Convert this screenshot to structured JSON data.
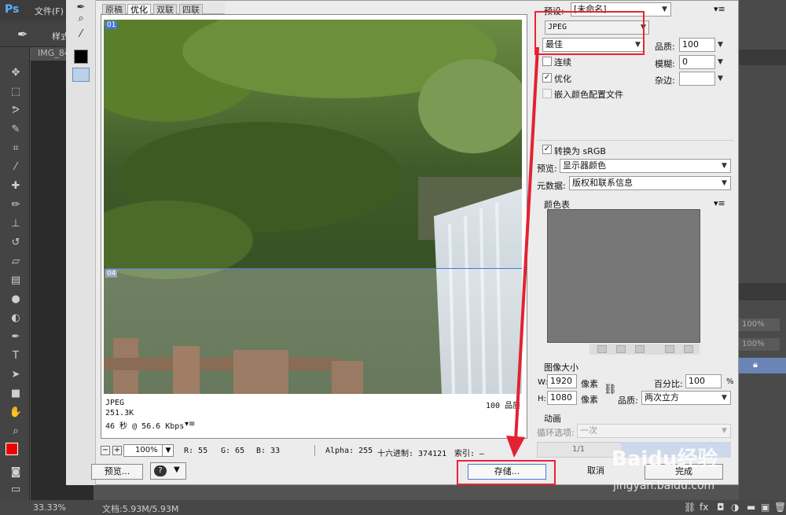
{
  "ps": {
    "logo": "Ps",
    "menu_file": "文件(F)",
    "style_label": "样式",
    "doc_tab": "IMG_84",
    "zoom": "33.33%",
    "doc_size": "文档:5.93M/5.93M",
    "pct1": "100%",
    "pct2": "100%"
  },
  "dialog": {
    "view_tabs": [
      "原稿",
      "优化",
      "双联",
      "四联"
    ],
    "slice_01": "01",
    "slice_04": "04",
    "info": {
      "format": "JPEG",
      "size": "251.3K",
      "time": "46 秒 @ 56.6 Kbps",
      "menu": "▾≡",
      "quality": "100 品质"
    },
    "status": {
      "zoom": "100%",
      "r": "R: 55",
      "g": "G: 65",
      "b": "B: 33",
      "alpha": "Alpha: 255",
      "hex": "十六进制: 374121",
      "index": "索引: —"
    },
    "buttons": {
      "preview": "预览...",
      "save": "存储...",
      "cancel": "取消",
      "done": "完成"
    }
  },
  "settings": {
    "preset_label": "预设:",
    "preset_value": "[未命名]",
    "format": "JPEG",
    "quality_preset": "最佳",
    "quality_label": "品质:",
    "quality_value": "100",
    "progressive": "连续",
    "blur_label": "模糊:",
    "blur_value": "0",
    "optimized": "优化",
    "matte_label": "杂边:",
    "embed_profile": "嵌入颜色配置文件",
    "convert_srgb": "转换为 sRGB",
    "preview_label": "预览:",
    "preview_value": "显示器颜色",
    "metadata_label": "元数据:",
    "metadata_value": "版权和联系信息",
    "color_table": "颜色表",
    "image_size": "图像大小",
    "w_label": "W:",
    "w_value": "1920",
    "h_label": "H:",
    "h_value": "1080",
    "px": "像素",
    "percent_label": "百分比:",
    "percent_value": "100",
    "percent_unit": "%",
    "resample_label": "品质:",
    "resample_value": "两次立方",
    "animation": "动画",
    "loop_label": "循环选项:",
    "loop_value": "一次",
    "frame": "1/1"
  },
  "watermark": {
    "brand": "Baidu经验",
    "url": "jingyan.baidu.com"
  },
  "colors": {
    "highlight_red": "#e22233",
    "slice_blue": "#4a78d8"
  }
}
